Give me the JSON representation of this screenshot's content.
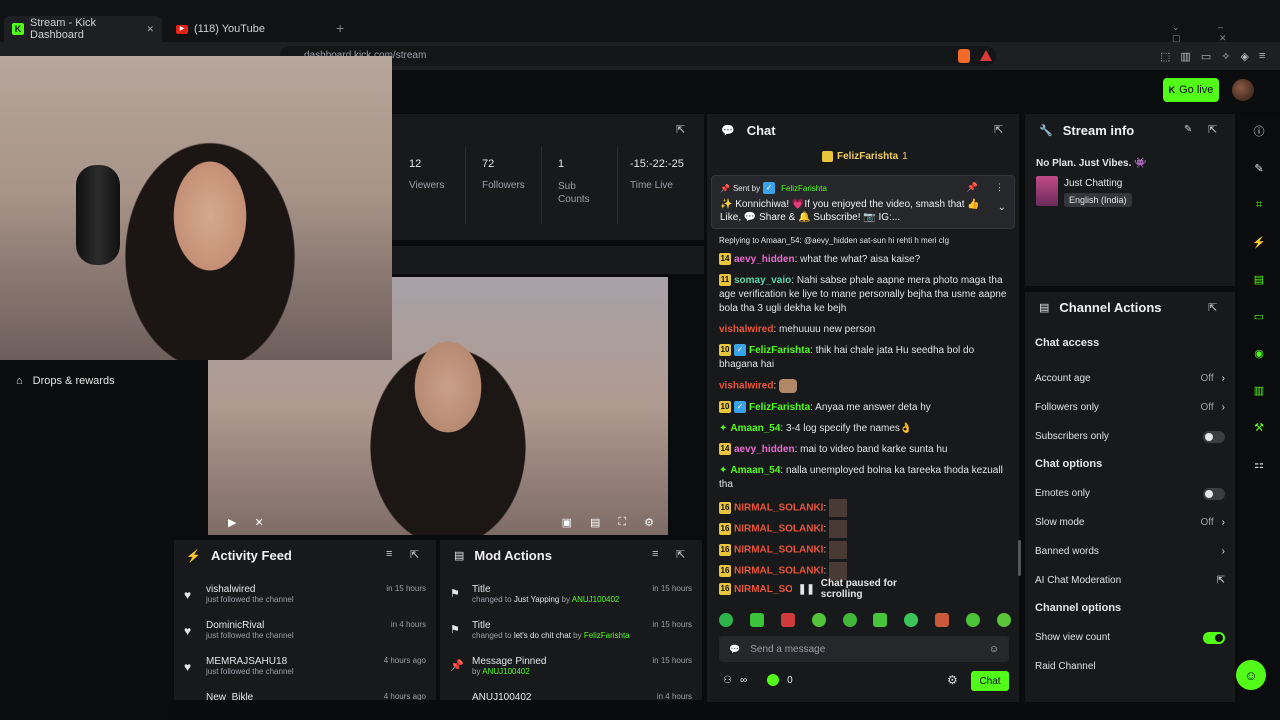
{
  "browser": {
    "tabs": [
      {
        "label": "Stream - Kick Dashboard",
        "close": "✕",
        "icon": "K"
      },
      {
        "label": "(118) YouTube",
        "icon": "▶"
      }
    ],
    "new_tab": "+",
    "url": "dashboard.kick.com/stream"
  },
  "header": {
    "go_live": "Go live"
  },
  "stats": [
    {
      "value": "12",
      "label": "Viewers"
    },
    {
      "value": "72",
      "label": "Followers"
    },
    {
      "value": "1",
      "label": "Sub Counts"
    },
    {
      "value": "-15:-22:-25",
      "label": "Time Live"
    }
  ],
  "sidebar": {
    "drops": "Drops & rewards"
  },
  "activity_feed": {
    "title": "Activity Feed",
    "items": [
      {
        "name": "vishalwired",
        "sub": "just followed the channel",
        "time": "in 15 hours"
      },
      {
        "name": "DominicRival",
        "sub": "just followed the channel",
        "time": "in 4 hours"
      },
      {
        "name": "MEMRAJSAHU18",
        "sub": "just followed the channel",
        "time": "4 hours ago"
      },
      {
        "name": "New_Bikle",
        "sub": "",
        "time": "4 hours ago"
      }
    ]
  },
  "mod_actions": {
    "title": "Mod Actions",
    "items": [
      {
        "title": "Title",
        "pre": "changed to ",
        "value": "Just Yapping",
        "by": " by ",
        "user": "ANUJ100402",
        "time": "in 15 hours"
      },
      {
        "title": "Title",
        "pre": "changed to ",
        "value": "let's do chit chat",
        "by": " by ",
        "user": "FelizFarishta",
        "time": "in 15 hours"
      },
      {
        "title": "Message Pinned",
        "pre": "by ",
        "value": "",
        "by": "",
        "user": "ANUJ100402",
        "time": "in 15 hours"
      },
      {
        "title": "ANUJ100402",
        "pre": "",
        "value": "",
        "by": "",
        "user": "",
        "time": "in 4 hours"
      }
    ]
  },
  "chat": {
    "title": "Chat",
    "top_gifter": {
      "name": "FelizFarishta",
      "count": "1"
    },
    "pinned": {
      "sent_by_label": "Sent by",
      "sent_by": "FelizFarishta",
      "text": "✨ Konnichiwa! 💗If you enjoyed the video, smash that 👍 Like, 💬 Share & 🔔 Subscribe! 📷 IG:..."
    },
    "reply": "Replying to Amaan_54: @aevy_hidden sat-sun hi rehti h meri clg",
    "messages": [
      {
        "badge": "14",
        "user": "aevy_hidden",
        "color": "#e86bd0",
        "text": "what the what? aisa kaise?"
      },
      {
        "badge": "11",
        "user": "somay_vaio",
        "color": "#5ad7a8",
        "text": "Nahi sabse phale aapne mera photo maga tha age verification ke liye to mane personally bejha tha usme aapne bola tha 3 ugli dekha ke bejh"
      },
      {
        "badge": "",
        "user": "vishalwired",
        "color": "#e8553a",
        "text": "mehuuuu new person"
      },
      {
        "badge": "10",
        "user": "FelizFarishta",
        "color": "#53fc18",
        "text": "thik hai chale jata Hu seedha bol do bhagana hai"
      },
      {
        "badge": "",
        "user": "vishalwired",
        "color": "#e8553a",
        "text": ""
      },
      {
        "badge": "10",
        "user": "FelizFarishta",
        "color": "#53fc18",
        "text": "Anyaa me answer deta hy"
      },
      {
        "badge": "✦",
        "user": "Amaan_54",
        "color": "#53fc18",
        "text": "3-4 log specify the names👌"
      },
      {
        "badge": "14",
        "user": "aevy_hidden",
        "color": "#e86bd0",
        "text": "mai to video band karke sunta hu"
      },
      {
        "badge": "✦",
        "user": "Amaan_54",
        "color": "#53fc18",
        "text": "nalla unemployed bolna ka tareeka thoda kezuall tha"
      },
      {
        "badge": "16",
        "user": "NIRMAL_SOLANKI",
        "color": "#e8553a",
        "text": ""
      },
      {
        "badge": "16",
        "user": "NIRMAL_SOLANKI",
        "color": "#e8553a",
        "text": ""
      },
      {
        "badge": "16",
        "user": "NIRMAL_SOLANKI",
        "color": "#e8553a",
        "text": ""
      },
      {
        "badge": "16",
        "user": "NIRMAL_SOLANKI",
        "color": "#e8553a",
        "text": ""
      },
      {
        "badge": "16",
        "user": "NIRMAL_SOI",
        "color": "#e8553a",
        "text": ""
      }
    ],
    "paused": "Chat paused for scrolling",
    "input_placeholder": "Send a message",
    "kick_count": "0",
    "send": "Chat"
  },
  "stream_info": {
    "title": "Stream info",
    "stream_title": "No Plan. Just Vibes. 👾",
    "category": "Just Chatting",
    "language": "English (India)"
  },
  "channel_actions": {
    "title": "Channel Actions",
    "chat_access": "Chat access",
    "account_age": {
      "label": "Account age",
      "value": "Off"
    },
    "followers_only": {
      "label": "Followers only",
      "value": "Off"
    },
    "subscribers_only": {
      "label": "Subscribers only",
      "on": false
    },
    "chat_options": "Chat options",
    "emotes_only": {
      "label": "Emotes only",
      "on": false
    },
    "slow_mode": {
      "label": "Slow mode",
      "value": "Off"
    },
    "banned_words": {
      "label": "Banned words"
    },
    "ai_moderation": {
      "label": "AI Chat Moderation"
    },
    "channel_options": "Channel options",
    "show_view_count": {
      "label": "Show view count",
      "on": true
    },
    "raid_channel": {
      "label": "Raid Channel"
    }
  }
}
